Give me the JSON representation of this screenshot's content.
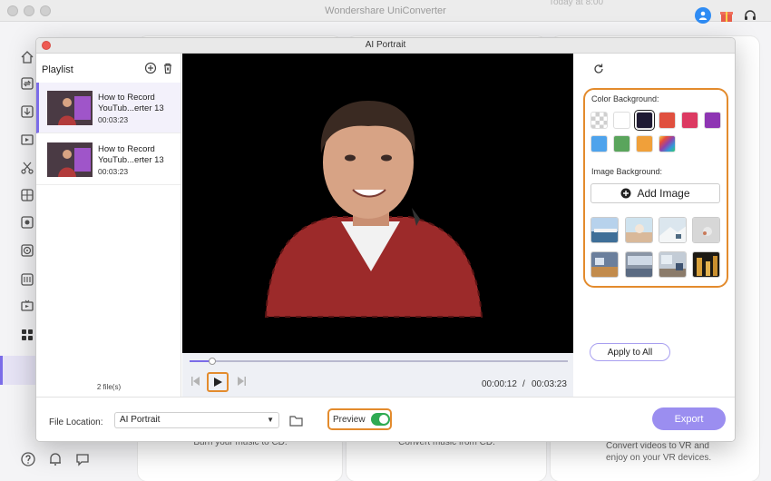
{
  "app": {
    "title": "Wondershare UniConverter",
    "title_right_fragment": "Today at 8:00"
  },
  "background_captions": [
    "Burn your music to CD.",
    "Convert music from CD.",
    "Convert videos to VR and enjoy on your VR devices."
  ],
  "dialog": {
    "title": "AI Portrait",
    "playlist": {
      "title": "Playlist",
      "items": [
        {
          "name": "How to Record YouTub...erter 13",
          "duration": "00:03:23",
          "active": true
        },
        {
          "name": "How to Record YouTub...erter 13",
          "duration": "00:03:23",
          "active": false
        }
      ],
      "file_count": "2 file(s)"
    },
    "player": {
      "progress": 0.06,
      "current_time": "00:00:12",
      "separator": "/",
      "total_time": "00:03:23"
    },
    "background_panel": {
      "color_label": "Color Background:",
      "colors": [
        "transparent",
        "#ffffff",
        "#1e1a33",
        "#e0503f",
        "#dc3a62",
        "#8e35b3",
        "#4ea3ec",
        "#5aa55c",
        "#f0a03a",
        "rainbow"
      ],
      "selected_color_index": 2,
      "image_label": "Image Background:",
      "add_image_label": "Add Image",
      "apply_all_label": "Apply to All"
    },
    "footer": {
      "file_location_label": "File Location:",
      "file_location_value": "AI Portrait",
      "preview_label": "Preview",
      "preview_on": true,
      "export_label": "Export"
    }
  },
  "colors": {
    "accent": "#7b6ce8",
    "highlight_outline": "#e38b2d",
    "export_button": "#9b8ef0",
    "toggle_on": "#2faa52"
  }
}
